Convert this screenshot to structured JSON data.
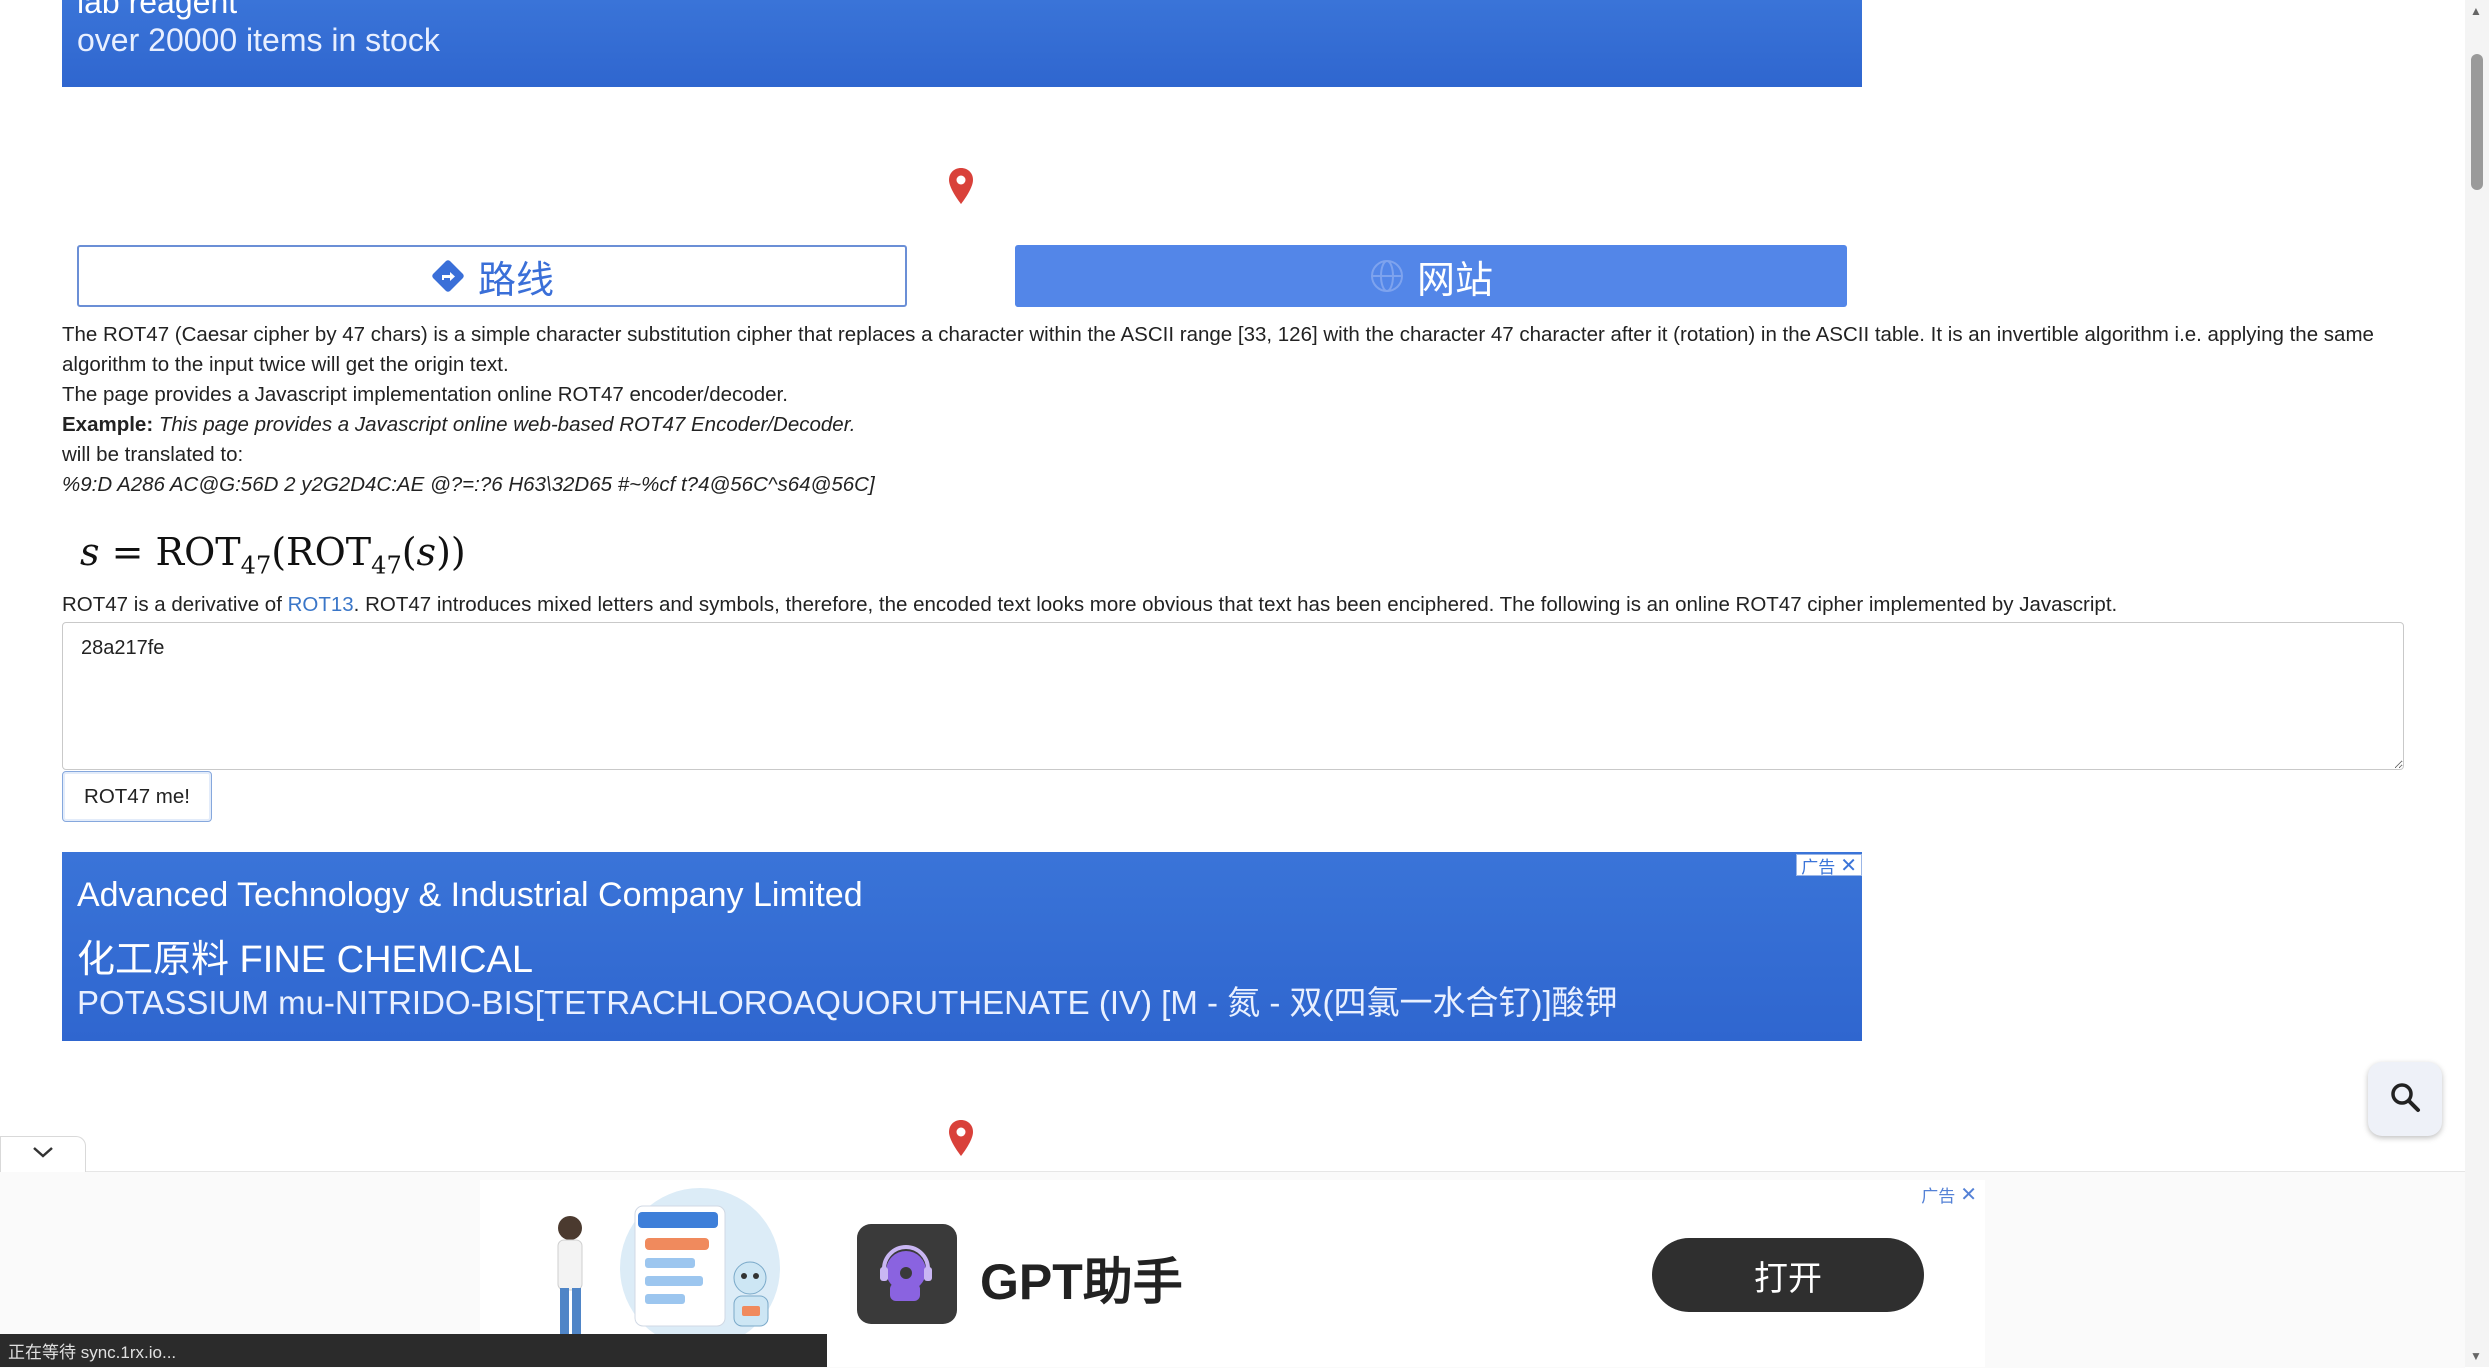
{
  "top_banner": {
    "line1": "lab reagent",
    "line2": "over 20000 items in stock"
  },
  "nav_buttons": {
    "route_label": "路线",
    "site_label": "网站"
  },
  "article": {
    "para1": "The ROT47 (Caesar cipher by 47 chars) is a simple character substitution cipher that replaces a character within the ASCII range [33, 126] with the character 47 character after it (rotation) in the ASCII table. It is an invertible algorithm i.e. applying the same algorithm to the input twice will get the origin text.",
    "para2": "The page provides a Javascript implementation online ROT47 encoder/decoder.",
    "example_label": "Example:",
    "example_text": "This page provides a Javascript online web-based ROT47 Encoder/Decoder.",
    "translated_label": "will be translated to:",
    "translated_text": "%9:D A286 AC@G:56D 2 y2G2D4C:AE @?=:?6 H63\\32D65 #~%cf t?4@56C^s64@56C]"
  },
  "formula": {
    "s": "s",
    "eq": "=",
    "rot": "ROT",
    "sub": "47",
    "open": "(",
    "inner_s": "s",
    "close": "))"
  },
  "derivative": {
    "prefix": "ROT47 is a derivative of ",
    "link": "ROT13",
    "suffix": ". ROT47 introduces mixed letters and symbols, therefore, the encoded text looks more obvious that text has been enciphered. The following is an online ROT47 cipher implemented by Javascript."
  },
  "cipher": {
    "input_value": "28a217fe",
    "button_label": "ROT47 me!"
  },
  "mid_banner": {
    "line1": "Advanced Technology & Industrial Company Limited",
    "line2": "化工原料 FINE CHEMICAL",
    "line3": "POTASSIUM mu-NITRIDO-BIS[TETRACHLOROAQUORUTHENATE (IV) [M - 氮 - 双(四氯一水合钌)]酸钾",
    "ad_tag": "广告"
  },
  "bottom_ad": {
    "ad_tag": "广告",
    "title": "GPT助手",
    "open_label": "打开"
  },
  "status": {
    "text": "正在等待 sync.1rx.io..."
  },
  "colors": {
    "banner_blue": "#2f66cf",
    "button_blue": "#5386e8",
    "pin_red": "#d9413a",
    "link_blue": "#3a76c8"
  }
}
